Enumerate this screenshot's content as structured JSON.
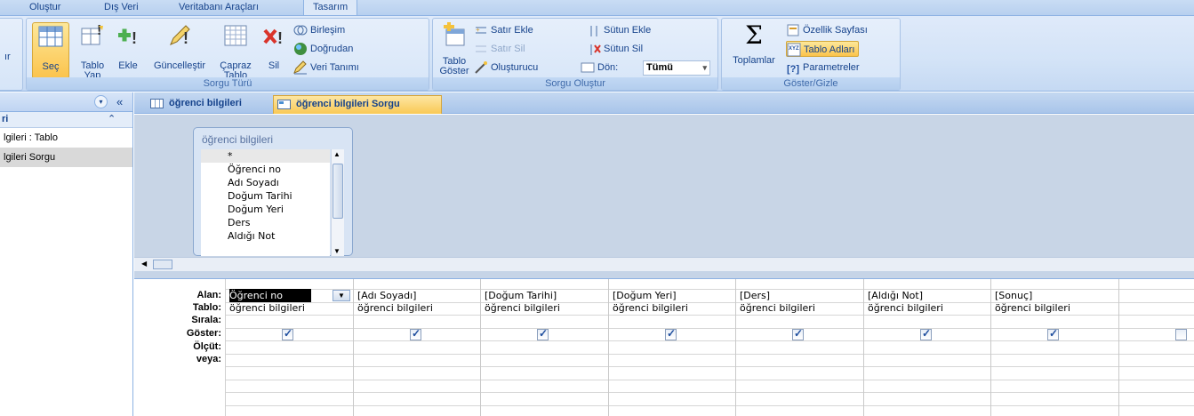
{
  "ribbon_tabs": [
    "Oluştur",
    "Dış Veri",
    "Veritabanı Araçları",
    "Tasarım"
  ],
  "groups": {
    "cut_label": "ır",
    "sorgu_turu": {
      "label": "Sorgu Türü",
      "sec": "Seç",
      "tablo_yap_1": "Tablo",
      "tablo_yap_2": "Yap",
      "ekle": "Ekle",
      "guncellestir": "Güncelleştir",
      "capraz_1": "Çapraz",
      "capraz_2": "Tablo",
      "sil": "Sil",
      "birlesim": "Birleşim",
      "dogrudan": "Doğrudan",
      "veri_tanimi": "Veri Tanımı"
    },
    "sorgu_olustur": {
      "label": "Sorgu Oluştur",
      "tablo_goster_1": "Tablo",
      "tablo_goster_2": "Göster",
      "satir_ekle": "Satır Ekle",
      "satir_sil": "Satır Sil",
      "olusturucu": "Oluşturucu",
      "sutun_ekle": "Sütun Ekle",
      "sutun_sil": "Sütun Sil",
      "don_label": "Dön:",
      "don_value": "Tümü"
    },
    "goster_gizle": {
      "label": "Göster/Gizle",
      "toplamlar": "Toplamlar",
      "ozellik_sayfasi": "Özellik Sayfası",
      "tablo_adlari": "Tablo Adları",
      "parametreler": "Parametreler"
    }
  },
  "nav": {
    "header_chevrons": "«",
    "sub_label": "ri",
    "items": [
      "lgileri : Tablo",
      "lgileri Sorgu"
    ]
  },
  "doc_tabs": [
    "öğrenci bilgileri",
    "öğrenci bilgileri Sorgu"
  ],
  "table_box": {
    "title": "öğrenci bilgileri",
    "fields": [
      "*",
      "Öğrenci no",
      "Adı Soyadı",
      "Doğum Tarihi",
      "Doğum Yeri",
      "Ders",
      "Aldığı Not"
    ]
  },
  "grid": {
    "row_labels": [
      "Alan:",
      "Tablo:",
      "Sırala:",
      "Göster:",
      "Ölçüt:",
      "veya:"
    ],
    "columns": [
      {
        "field": "Öğrenci no",
        "table": "öğrenci bilgileri",
        "show": true
      },
      {
        "field": "[Adı Soyadı]",
        "table": "öğrenci bilgileri",
        "show": true
      },
      {
        "field": "[Doğum Tarihi]",
        "table": "öğrenci bilgileri",
        "show": true
      },
      {
        "field": "[Doğum Yeri]",
        "table": "öğrenci bilgileri",
        "show": true
      },
      {
        "field": "[Ders]",
        "table": "öğrenci bilgileri",
        "show": true
      },
      {
        "field": "[Aldığı Not]",
        "table": "öğrenci bilgileri",
        "show": true
      },
      {
        "field": "[Sonuç]",
        "table": "öğrenci bilgileri",
        "show": true
      },
      {
        "field": "",
        "table": "",
        "show": false
      }
    ]
  }
}
